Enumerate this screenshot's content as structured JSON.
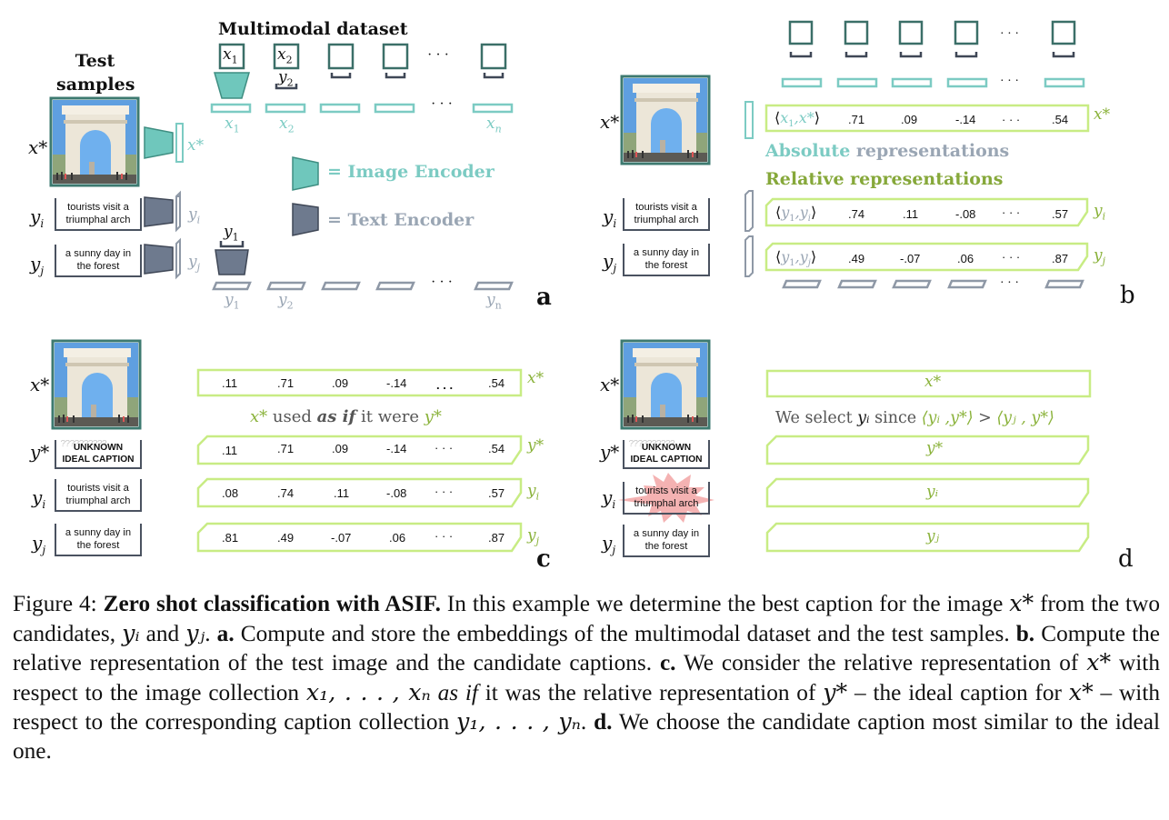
{
  "figure": {
    "panels": {
      "a": {
        "letter": "a",
        "test_samples_title_line1": "Test",
        "test_samples_title_line2": "samples",
        "dataset_title": "Multimodal dataset",
        "image_encoder_legend": "= Image Encoder",
        "text_encoder_legend": "= Text Encoder",
        "x_star_label": "x*",
        "x_star_embed_label": "x*",
        "y_i_label": "y",
        "y_i_sub": "i",
        "y_j_label": "y",
        "y_j_sub": "j",
        "dataset_image_labels": [
          "x1",
          "x2",
          "",
          "",
          "…",
          ""
        ],
        "dataset_caption_labels": [
          "y2",
          "y1"
        ],
        "x_embedding_labels": [
          "x1",
          "x2",
          "…",
          "xn"
        ],
        "y_embedding_labels": [
          "y1",
          "y2",
          "…",
          "yn"
        ],
        "ellipsis": "· · ·"
      },
      "b": {
        "letter": "b",
        "absolute_word": "Absolute",
        "representations_word": " representations",
        "relative_title": "Relative representations",
        "rows": [
          {
            "label": "x*",
            "first": "⟨x₁,x*⟩",
            "values": [
              ".71",
              ".09",
              "-.14",
              "· · ·",
              ".54"
            ]
          },
          {
            "label": "yi",
            "first": "⟨y₁,yᵢ⟩",
            "values": [
              ".74",
              ".11",
              "-.08",
              "· · ·",
              ".57"
            ]
          },
          {
            "label": "yj",
            "first": "⟨y₁,yⱼ⟩",
            "values": [
              ".49",
              "-.07",
              ".06",
              "· · ·",
              ".87"
            ]
          }
        ],
        "ellipsis": "· · ·"
      },
      "c": {
        "letter": "c",
        "annotation_pre": "x*",
        "annotation_used": " used ",
        "annotation_asif": "as if",
        "annotation_it_were": " it were ",
        "annotation_post": "y*",
        "rows": [
          {
            "label": "x*",
            "values": [
              ".11",
              ".71",
              ".09",
              "-.14",
              ". . .",
              ".54"
            ]
          },
          {
            "label": "y*",
            "values": [
              ".11",
              ".71",
              ".09",
              "-.14",
              "· · ·",
              ".54"
            ]
          },
          {
            "label": "yi",
            "values": [
              ".08",
              ".74",
              ".11",
              "-.08",
              "· · ·",
              ".57"
            ]
          },
          {
            "label": "yj",
            "values": [
              ".81",
              ".49",
              "-.07",
              ".06",
              "· · ·",
              ".87"
            ]
          }
        ]
      },
      "d": {
        "letter": "d",
        "selection_text_pre": "We select ",
        "selection_yi": "yᵢ",
        "selection_since": " since ",
        "selection_lhs": "⟨yᵢ ,y*⟩",
        "selection_gt": " > ",
        "selection_rhs": "⟨yⱼ , y*⟩",
        "rows": [
          {
            "label": "x*",
            "inner": "x*"
          },
          {
            "label": "y*",
            "inner": "y*"
          },
          {
            "label": "yi",
            "inner": "yᵢ"
          },
          {
            "label": "yj",
            "inner": "yⱼ"
          }
        ],
        "selected_caption": "tourists visit a triumphal arch"
      }
    },
    "captions": {
      "yi_line1": "tourists visit a",
      "yi_line2": "triumphal arch",
      "yj_line1": "a sunny day in",
      "yj_line2": "the forest",
      "unknown_qmarks": "??????????",
      "unknown_line1": "UNKNOWN",
      "unknown_line2": "IDEAL CAPTION"
    },
    "colors": {
      "image_encoder": "#6fc7bc",
      "image_encoder_dark": "#3f8e82",
      "text_encoder": "#6e7a8e",
      "text_encoder_dark": "#3f4756",
      "relative_green": "#c8ec84",
      "relative_text_green": "#86a83a",
      "teal_label": "#7ccbc3",
      "slate_label": "#9aa6b4",
      "highlight": "#f2a4a4"
    }
  },
  "caption": {
    "figure_label": "Figure 4: ",
    "title_bold": "Zero shot classification with ASIF.",
    "sentence1_a": " In this example we determine the best caption for the image ",
    "x_star": "x*",
    "sentence1_b": " from the two candidates, ",
    "y_i": "yᵢ",
    "and": " and ",
    "y_j": "yⱼ",
    "period1": ". ",
    "a_label": "a.",
    "a_text": " Compute and store the embeddings of the multimodal dataset and the test samples. ",
    "b_label": "b.",
    "b_text": " Compute the relative representation of the test image and the candidate captions. ",
    "c_label": "c.",
    "c_text_1": " We consider the relative representation of ",
    "c_text_2": " with respect to the image collection ",
    "x_collection": "x₁, . . . , xₙ",
    "as_if": "as if",
    "c_text_3": " it was the relative representation of ",
    "y_star": "y*",
    "c_text_4": " – the ideal caption for ",
    "c_text_5": " – with respect to the corresponding caption collection ",
    "y_collection": "y₁, . . . , yₙ",
    "period2": ". ",
    "d_label": "d.",
    "d_text": " We choose the candidate caption most similar to the ideal one."
  }
}
